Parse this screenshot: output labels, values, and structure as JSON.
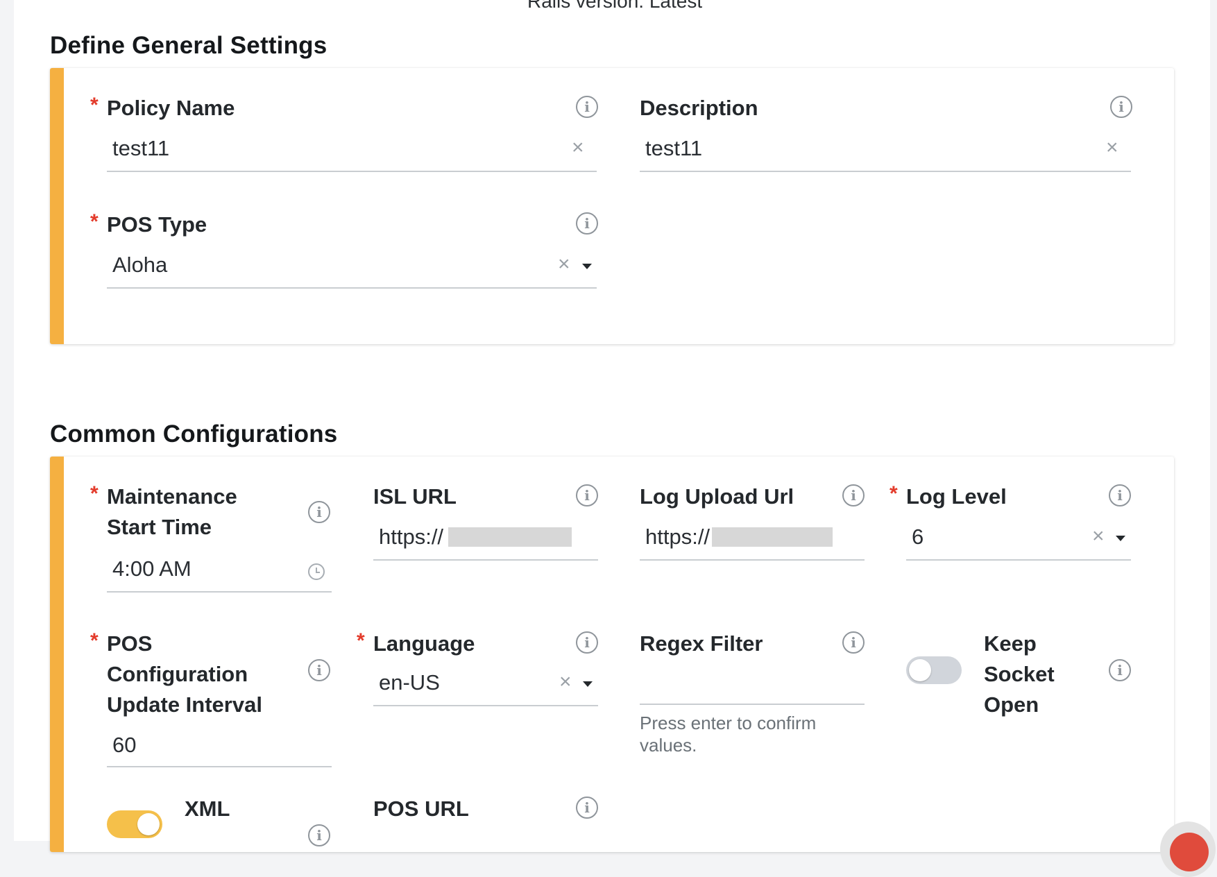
{
  "colors": {
    "accent": "#f5b041",
    "required": "#e33b2b",
    "toggle_off": "#d1d5db",
    "toggle_on": "#f5c04a"
  },
  "header": {
    "partial_text": "Rails version: Latest"
  },
  "general": {
    "title": "Define General Settings",
    "policy_name": {
      "label": "Policy Name",
      "value": "test11",
      "required_mark": "*"
    },
    "description": {
      "label": "Description",
      "value": "test11"
    },
    "pos_type": {
      "label": "POS Type",
      "value": "Aloha",
      "required_mark": "*"
    }
  },
  "common": {
    "title": "Common Configurations",
    "maintenance": {
      "label": "Maintenance Start Time",
      "line1": "Maintenance",
      "line2": "Start Time",
      "value": "4:00 AM",
      "required_mark": "*"
    },
    "isl_url": {
      "label": "ISL URL",
      "value": "https://"
    },
    "log_upload_url": {
      "label": "Log Upload Url",
      "value": "https://"
    },
    "log_level": {
      "label": "Log Level",
      "value": "6",
      "required_mark": "*"
    },
    "pos_config_interval": {
      "line1": "POS",
      "line2": "Configuration",
      "line3": "Update Interval",
      "value": "60",
      "required_mark": "*"
    },
    "language": {
      "label": "Language",
      "value": "en-US",
      "required_mark": "*"
    },
    "regex_filter": {
      "label": "Regex Filter",
      "value": "",
      "hint_line1": "Press enter to confirm",
      "hint_line2": "values."
    },
    "keep_socket_open": {
      "line1": "Keep",
      "line2": "Socket",
      "line3": "Open",
      "enabled": false
    },
    "xml": {
      "label": "XML",
      "enabled": true
    },
    "pos_url": {
      "label": "POS URL"
    }
  },
  "icons": {
    "info": "info-icon",
    "clear": "clear-icon",
    "caret": "caret-down-icon",
    "clock": "clock-icon"
  },
  "glyphs": {
    "info": "i",
    "clear": "×"
  }
}
